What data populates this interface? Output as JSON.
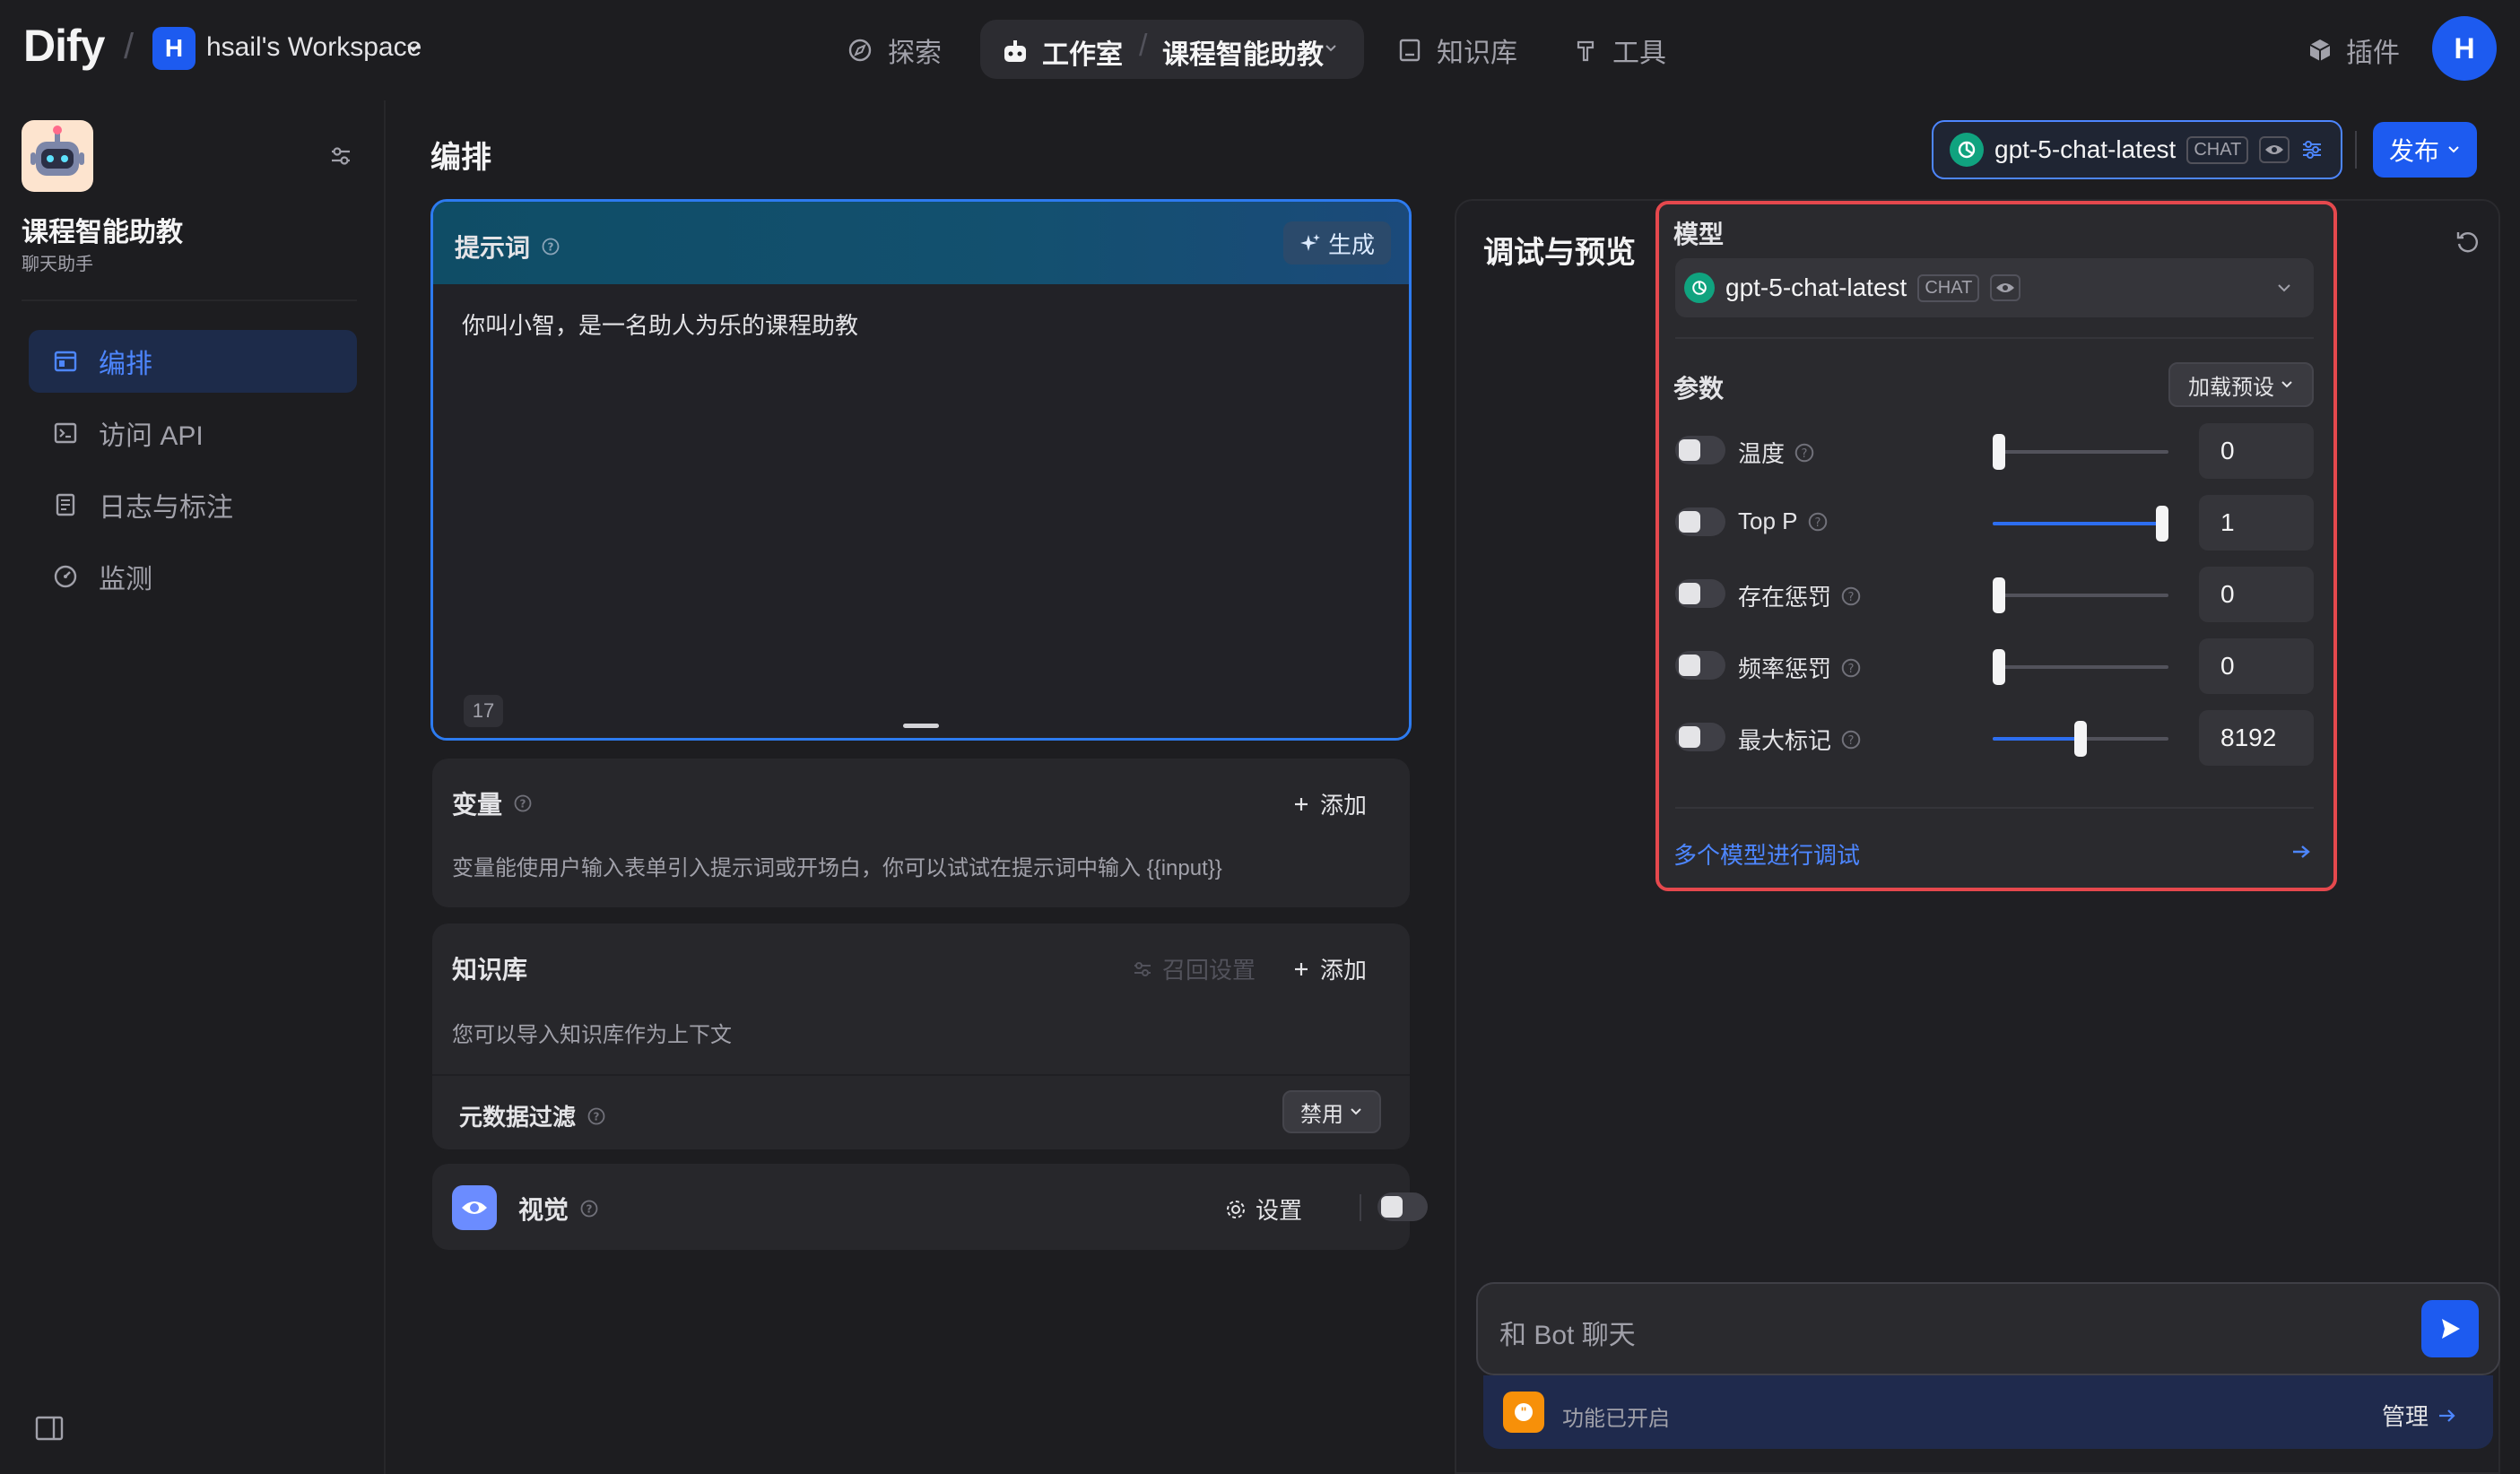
{
  "brand": {
    "logo": "Dify"
  },
  "workspace": {
    "initial": "H",
    "name": "hsail's Workspace"
  },
  "nav": {
    "explore": "探索",
    "studio": "工作室",
    "app_name": "课程智能助教",
    "knowledge": "知识库",
    "tools": "工具",
    "plugins": "插件"
  },
  "user": {
    "initial": "H"
  },
  "sidebar": {
    "app_name": "课程智能助教",
    "app_type": "聊天助手",
    "items": [
      {
        "label": "编排",
        "icon": "layout-icon",
        "active": true
      },
      {
        "label": "访问 API",
        "icon": "terminal-icon",
        "active": false
      },
      {
        "label": "日志与标注",
        "icon": "document-icon",
        "active": false
      },
      {
        "label": "监测",
        "icon": "gauge-icon",
        "active": false
      }
    ]
  },
  "main": {
    "title": "编排",
    "prompt": {
      "title": "提示词",
      "generate": "生成",
      "text": "你叫小智，是一名助人为乐的课程助教",
      "char_count": "17"
    },
    "variables": {
      "title": "变量",
      "add": "添加",
      "hint": "变量能使用户输入表单引入提示词或开场白，你可以试试在提示词中输入 {{input}}"
    },
    "knowledge": {
      "title": "知识库",
      "recall": "召回设置",
      "add": "添加",
      "hint": "您可以导入知识库作为上下文",
      "metadata_filter": "元数据过滤",
      "filter_value": "禁用"
    },
    "vision": {
      "title": "视觉",
      "settings": "设置",
      "enabled": false
    }
  },
  "debug": {
    "title": "调试与预览",
    "model_name": "gpt-5-chat-latest",
    "model_badge": "CHAT",
    "publish": "发布",
    "chat_placeholder": "和 Bot 聊天",
    "features_text": "功能已开启",
    "manage": "管理"
  },
  "popover": {
    "model_label": "模型",
    "model_name": "gpt-5-chat-latest",
    "model_badge": "CHAT",
    "params_label": "参数",
    "load_preset": "加载预设",
    "params": [
      {
        "label": "温度",
        "value": "0",
        "level": 0.0
      },
      {
        "label": "Top P",
        "value": "1",
        "level": 1.0
      },
      {
        "label": "存在惩罚",
        "value": "0",
        "level": 0.0
      },
      {
        "label": "频率惩罚",
        "value": "0",
        "level": 0.0
      },
      {
        "label": "最大标记",
        "value": "8192",
        "level": 0.5
      }
    ],
    "multi_model": "多个模型进行调试"
  },
  "colors": {
    "accent": "#1d5bf0",
    "link": "#4d86ff",
    "highlight_border": "#e5484d",
    "gpt_green": "#10a37f",
    "feature_orange": "#f79009"
  }
}
